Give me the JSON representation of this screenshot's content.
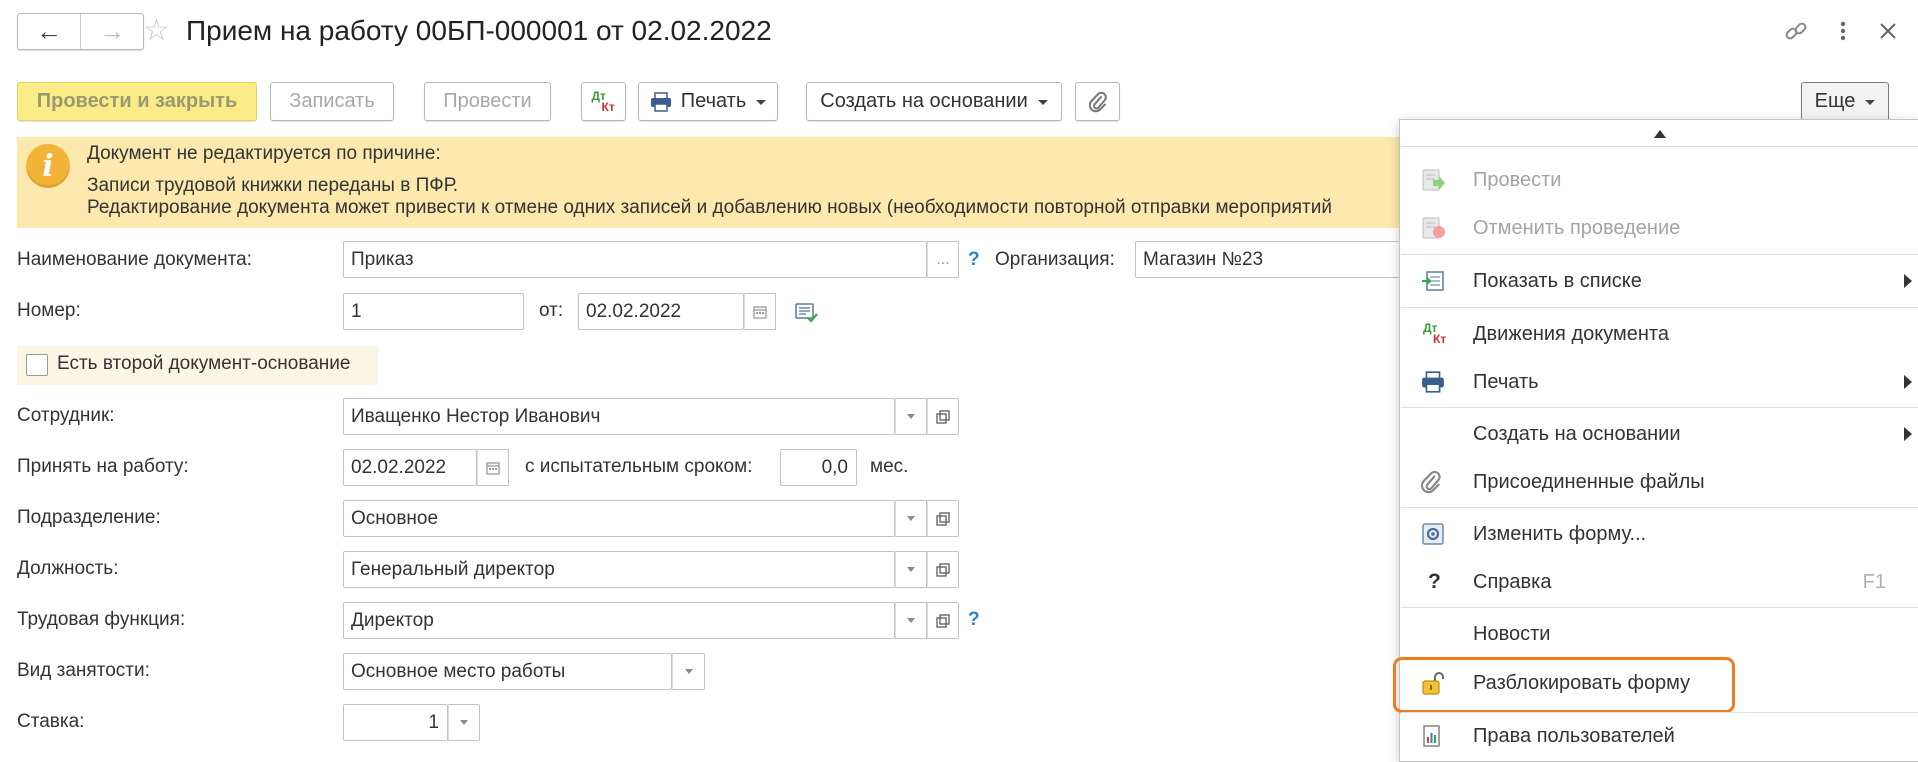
{
  "header": {
    "back_label": "←",
    "forward_label": "→",
    "title": "Прием на работу 00БП-000001 от 02.02.2022"
  },
  "toolbar": {
    "post_close": "Провести и закрыть",
    "save": "Записать",
    "post": "Провести",
    "dt": "Дт",
    "kt": "Кт",
    "print": "Печать",
    "create_based": "Создать на основании",
    "more": "Еще"
  },
  "banner": {
    "line1": "Документ не редактируется по причине:",
    "line2": "Записи трудовой книжки переданы в ПФР.",
    "line3": "Редактирование документа может привести к отмене одних записей и добавлению новых (необходимости повторной отправки мероприятий"
  },
  "form": {
    "doc_name_label": "Наименование документа:",
    "doc_name_value": "Приказ",
    "org_label": "Организация:",
    "org_value": "Магазин №23",
    "number_label": "Номер:",
    "number_value": "1",
    "from_label": "от:",
    "date_value": "02.02.2022",
    "second_basis_label": "Есть второй документ-основание",
    "employee_label": "Сотрудник:",
    "employee_value": "Иващенко Нестор Иванович",
    "hire_label": "Принять на работу:",
    "hire_date": "02.02.2022",
    "probation_label": "с испытательным сроком:",
    "probation_value": "0,0",
    "probation_unit": "мес.",
    "department_label": "Подразделение:",
    "department_value": "Основное",
    "position_label": "Должность:",
    "position_value": "Генеральный директор",
    "function_label": "Трудовая функция:",
    "function_value": "Директор",
    "employment_label": "Вид занятости:",
    "employment_value": "Основное место работы",
    "rate_label": "Ставка:",
    "rate_value": "1",
    "help_mark": "?"
  },
  "menu": {
    "items": [
      {
        "label": "Провести",
        "icon": "post-icon",
        "disabled": true
      },
      {
        "label": "Отменить проведение",
        "icon": "unpost-icon",
        "disabled": true
      },
      {
        "label": "Показать в списке",
        "icon": "show-in-list-icon",
        "submenu": true
      },
      {
        "label": "Движения документа",
        "icon": "dt-kt-icon"
      },
      {
        "label": "Печать",
        "icon": "printer-icon",
        "submenu": true
      },
      {
        "label": "Создать на основании",
        "icon": "",
        "submenu": true
      },
      {
        "label": "Присоединенные файлы",
        "icon": "paperclip-icon"
      },
      {
        "label": "Изменить форму...",
        "icon": "change-form-icon"
      },
      {
        "label": "Справка",
        "icon": "help-icon",
        "shortcut": "F1"
      },
      {
        "label": "Новости",
        "icon": ""
      },
      {
        "label": "Разблокировать форму",
        "icon": "unlock-icon",
        "highlighted": true
      },
      {
        "label": "Права пользователей",
        "icon": "user-rights-icon"
      }
    ]
  },
  "colors": {
    "primary_button": "#fbec88",
    "banner_background": "#fde9ad",
    "info_icon": "#f2b339",
    "help_blue": "#2e7fc5",
    "highlight_outline": "#f07b1f"
  }
}
